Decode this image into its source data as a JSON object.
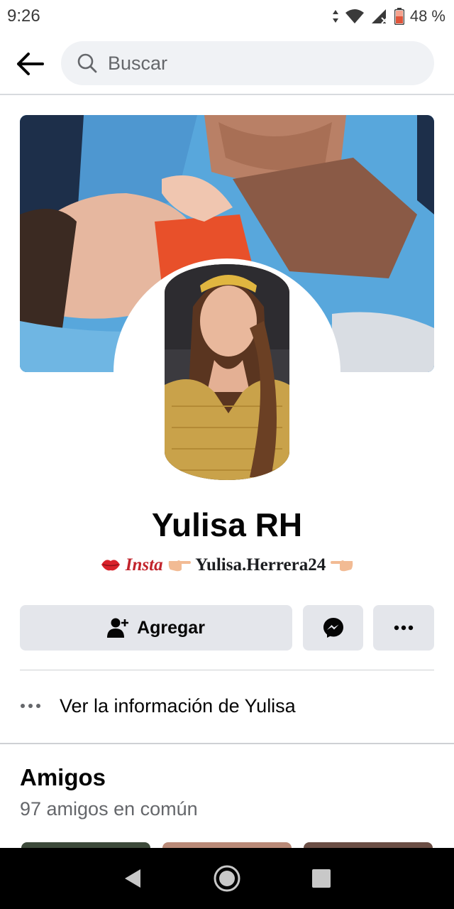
{
  "status_bar": {
    "time": "9:26",
    "battery": "48 %"
  },
  "header": {
    "search_placeholder": "Buscar"
  },
  "profile": {
    "name": "Yulisa RH",
    "bio_insta": "Insta",
    "bio_handle": "Yulisa.Herrera24"
  },
  "actions": {
    "add_label": "Agregar"
  },
  "info": {
    "label": "Ver la información de Yulisa"
  },
  "friends": {
    "title": "Amigos",
    "mutual": "97 amigos en común"
  },
  "colors": {
    "button_bg": "#e4e6eb",
    "text_primary": "#050505",
    "text_secondary": "#65676b",
    "divider": "#ced0d4"
  }
}
